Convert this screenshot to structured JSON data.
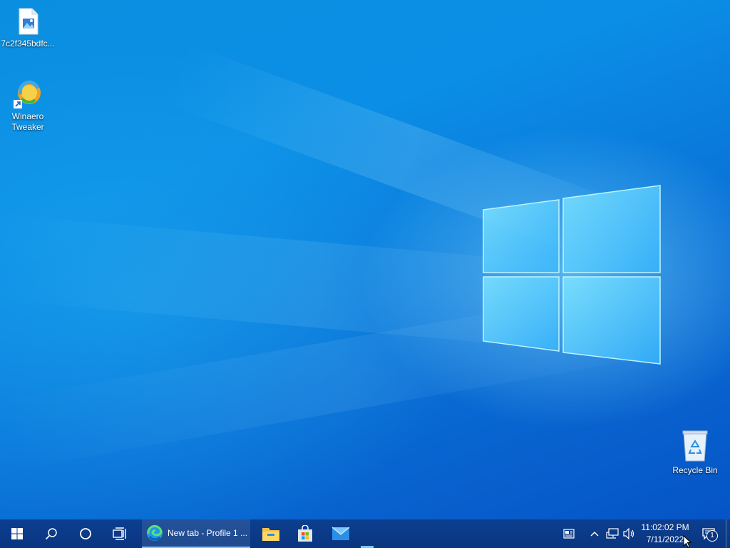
{
  "desktop": {
    "icons": [
      {
        "name": "image-file",
        "label": "7c2f345bdfc..."
      },
      {
        "name": "winaero-tweaker",
        "label_line1": "Winaero",
        "label_line2": "Tweaker"
      },
      {
        "name": "recycle-bin",
        "label": "Recycle Bin"
      }
    ]
  },
  "taskbar": {
    "edge_task_label": "New tab - Profile 1 ...",
    "clock": {
      "time": "11:02:02 PM",
      "date": "7/11/2022"
    },
    "notification_count": "1"
  },
  "colors": {
    "taskbar": "#0a3580",
    "wallpaper_accent": "#0a8fe0"
  }
}
